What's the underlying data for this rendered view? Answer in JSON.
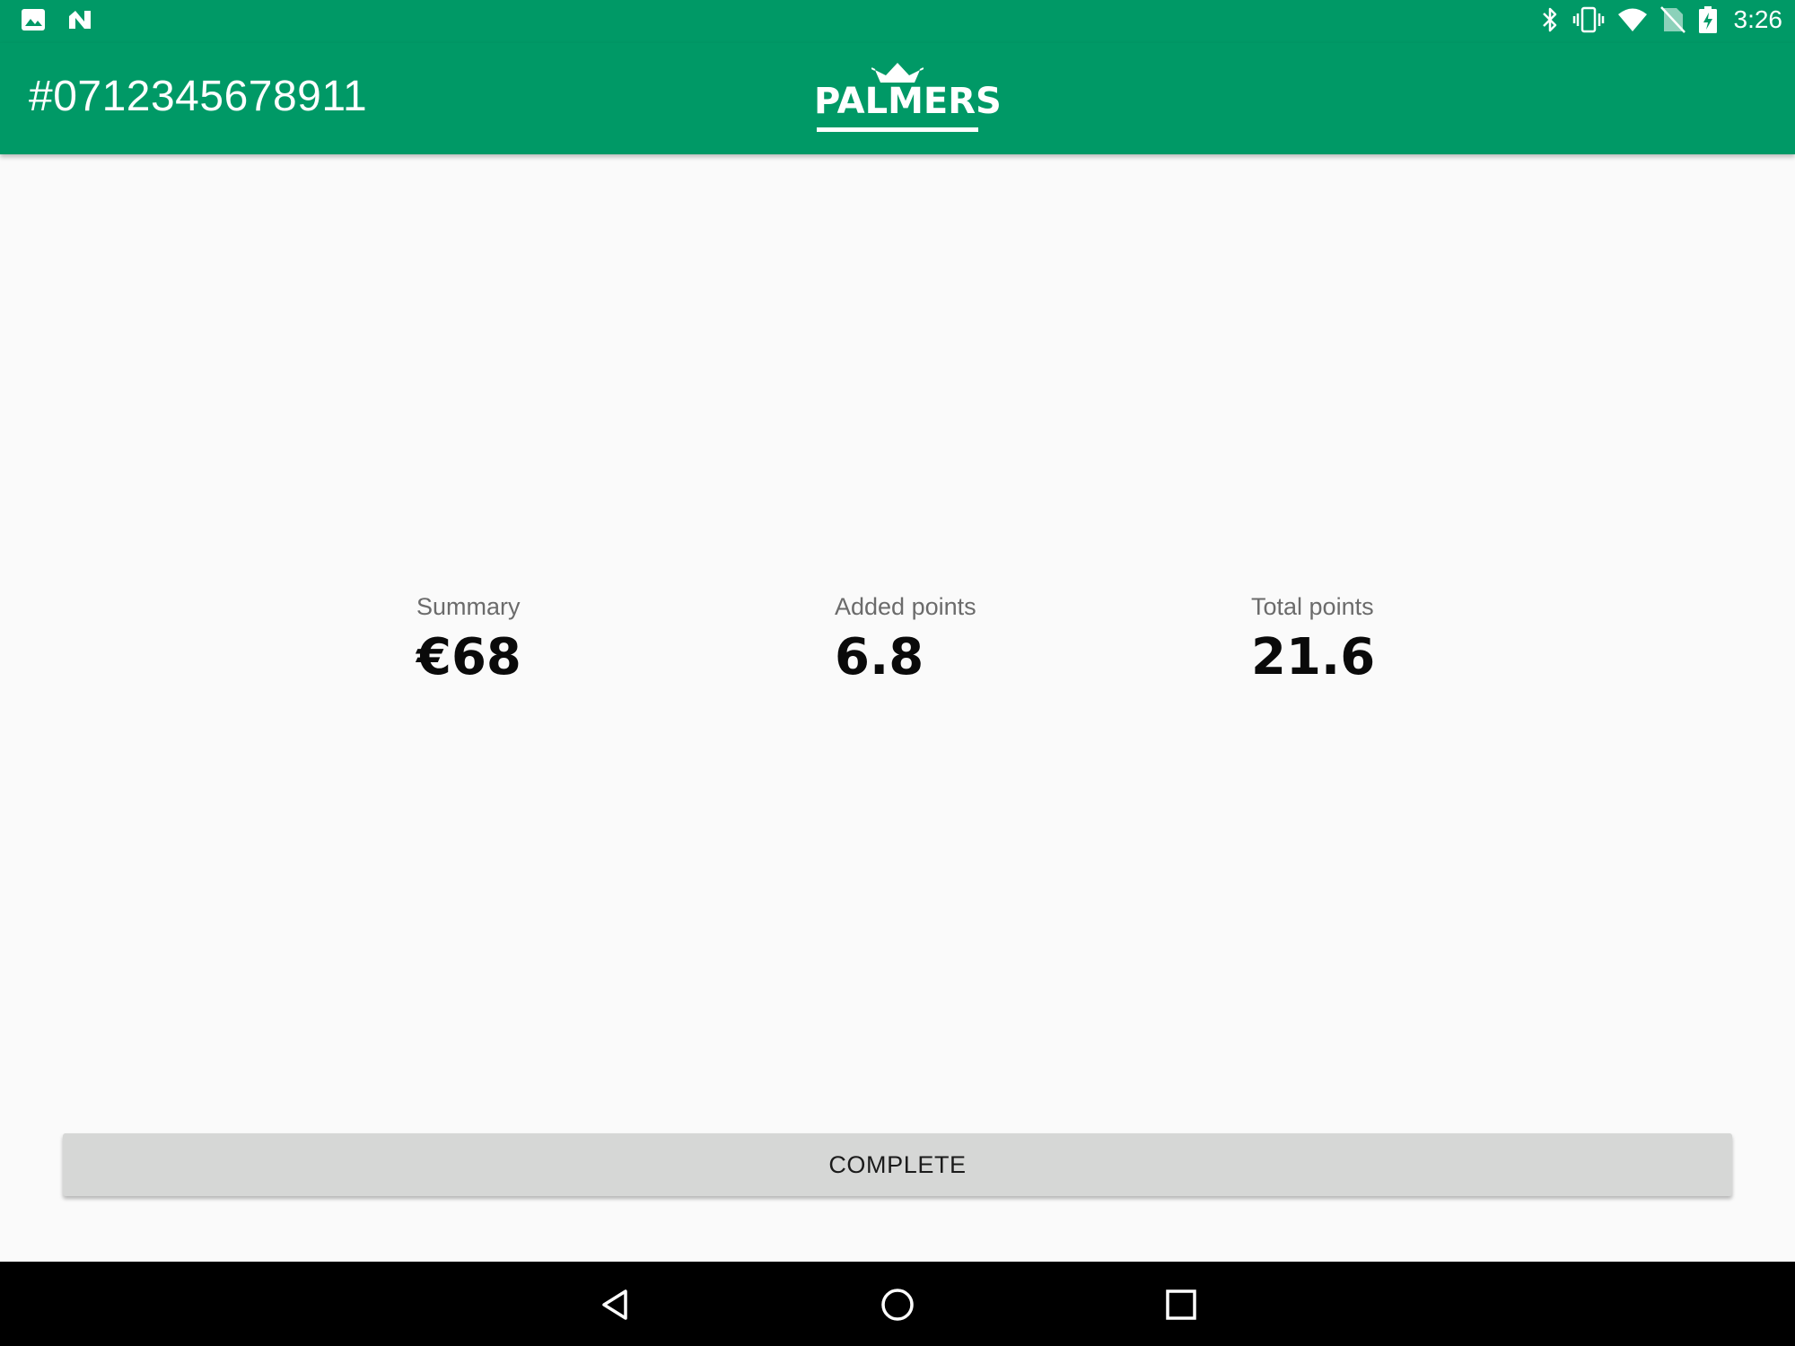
{
  "status_bar": {
    "time": "3:26",
    "left_icons": [
      "image-icon",
      "n-notification-icon"
    ],
    "right_icons": [
      "bluetooth-icon",
      "vibrate-icon",
      "wifi-icon",
      "no-sim-icon",
      "battery-charging-icon"
    ]
  },
  "app_bar": {
    "order_number": "#0712345678911",
    "logo_text": "PALMERS",
    "color": "#009966"
  },
  "summary": {
    "label": "Summary",
    "value": "€68"
  },
  "added_points": {
    "label": "Added points",
    "value": "6.8"
  },
  "total_points": {
    "label": "Total points",
    "value": "21.6"
  },
  "actions": {
    "complete_label": "COMPLETE"
  },
  "nav_bar": {
    "buttons": [
      "back-icon",
      "home-icon",
      "recents-icon"
    ]
  }
}
